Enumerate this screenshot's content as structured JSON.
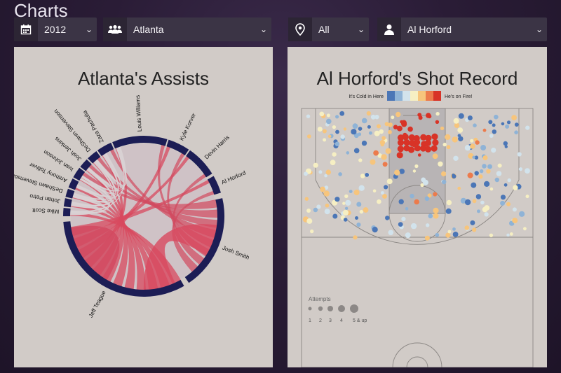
{
  "header": {
    "title": "Charts"
  },
  "filters": {
    "year": {
      "value": "2012",
      "icon": "calendar-icon"
    },
    "team": {
      "value": "Atlanta",
      "icon": "group-icon"
    },
    "location": {
      "value": "All",
      "icon": "map-pin-icon"
    },
    "player": {
      "value": "Al Horford",
      "icon": "user-icon"
    }
  },
  "assists_panel": {
    "title": "Atlanta's Assists",
    "players": [
      "Mike Scott",
      "Johan Petro",
      "DeShawn Stevenson",
      "Anthony Tolliver",
      "Ivan Johnson",
      "Josh Jenkins",
      "DeShawn Stevenson",
      "Zaza Pachulia",
      "Louis Williams",
      "Kyle Korver",
      "Devin Harris",
      "Al Horford",
      "Josh Smith",
      "Jeff Teague"
    ]
  },
  "shots_panel": {
    "title": "Al Horford's Shot Record",
    "legend_cold": "It's Cold in Here",
    "legend_hot": "He's on Fire!",
    "heat_colors": [
      "#4b76b6",
      "#8fb3d6",
      "#d2e3ec",
      "#f6efc3",
      "#f7c57c",
      "#ec7b4c",
      "#d83327"
    ],
    "attempts_label": "Attempts",
    "attempts_ticks": [
      "1",
      "2",
      "3",
      "4",
      "5 & up"
    ]
  }
}
